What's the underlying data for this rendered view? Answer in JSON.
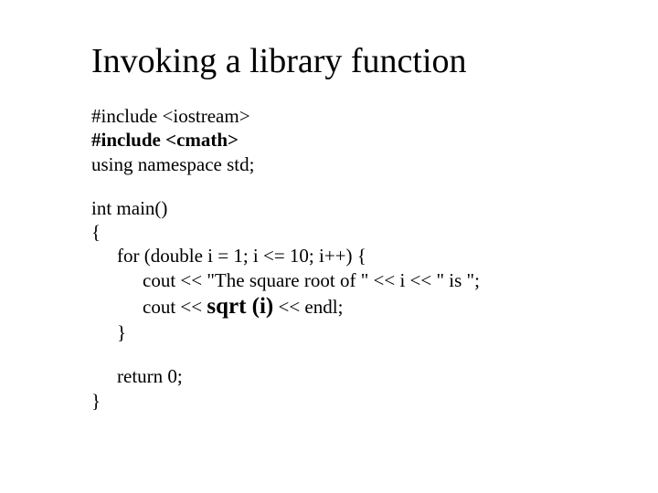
{
  "title": "Invoking a library function",
  "code": {
    "line1": "#include <iostream>",
    "line2": "#include <cmath>",
    "line3": "using namespace std;",
    "line4": "int main()",
    "line5": "{",
    "line6": "for (double i = 1; i <= 10; i++) {",
    "line7": "cout << \"The square root of \" << i << \" is \";",
    "line8_a": "cout << ",
    "line8_bold": "sqrt (i)",
    "line8_b": " << endl;",
    "line9": "}",
    "line10": "return 0;",
    "line11": "}"
  }
}
